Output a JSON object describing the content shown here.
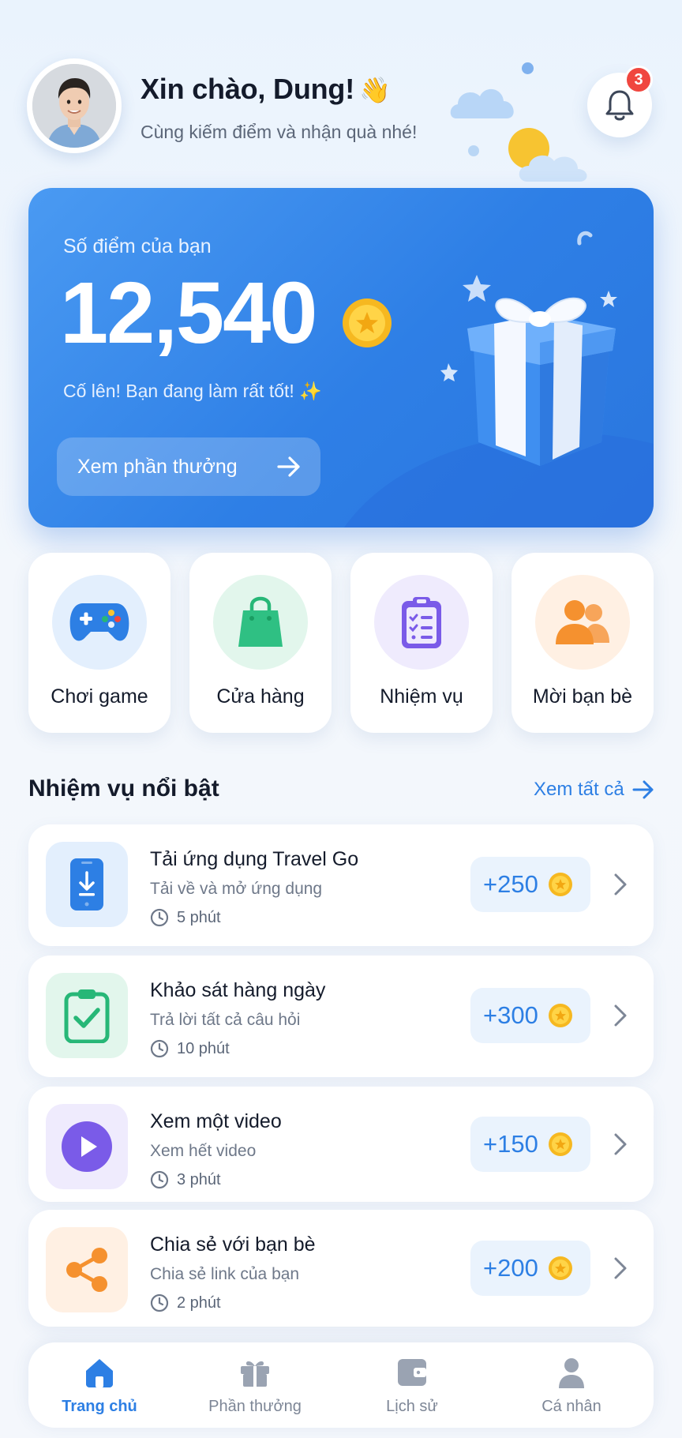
{
  "header": {
    "greeting": "Xin chào, Dung!",
    "wave_emoji": "👋",
    "subtitle": "Cùng kiếm điểm và nhận quà nhé!",
    "notification_count": "3"
  },
  "points_card": {
    "label": "Số điểm của bạn",
    "value": "12,540",
    "cheer": "Cố lên! Bạn đang làm rất tốt! ✨",
    "button_label": "Xem phần thưởng"
  },
  "quick_actions": [
    {
      "label": "Chơi game",
      "icon": "gamepad-icon",
      "bg": "#e3effd",
      "color": "#2d7fe4"
    },
    {
      "label": "Cửa hàng",
      "icon": "shopping-bag-icon",
      "bg": "#e2f6ec",
      "color": "#27b777"
    },
    {
      "label": "Nhiệm vụ",
      "icon": "clipboard-list-icon",
      "bg": "#efebfd",
      "color": "#7a5be8"
    },
    {
      "label": "Mời bạn bè",
      "icon": "users-icon",
      "bg": "#fff0e3",
      "color": "#f5912f"
    }
  ],
  "featured": {
    "title": "Nhiệm vụ nổi bật",
    "see_all": "Xem tất cả"
  },
  "missions": [
    {
      "title": "Tải ứng dụng Travel Go",
      "desc": "Tải về và mở ứng dụng",
      "time": "5 phút",
      "points": "+250",
      "icon": "phone-download-icon"
    },
    {
      "title": "Khảo sát hàng ngày",
      "desc": "Trả lời tất cả câu hỏi",
      "time": "10 phút",
      "points": "+300",
      "icon": "clipboard-check-icon"
    },
    {
      "title": "Xem một video",
      "desc": "Xem hết video",
      "time": "3 phút",
      "points": "+150",
      "icon": "play-icon"
    },
    {
      "title": "Chia sẻ với bạn bè",
      "desc": "Chia sẻ link của bạn",
      "time": "2 phút",
      "points": "+200",
      "icon": "share-icon"
    }
  ],
  "bottom_nav": [
    {
      "label": "Trang chủ",
      "icon": "home-icon",
      "active": true
    },
    {
      "label": "Phần thưởng",
      "icon": "gift-icon",
      "active": false
    },
    {
      "label": "Lịch sử",
      "icon": "wallet-icon",
      "active": false
    },
    {
      "label": "Cá nhân",
      "icon": "user-icon",
      "active": false
    }
  ],
  "colors": {
    "primary": "#2d7fe4",
    "badge": "#f0463f",
    "coin": "#f6b820"
  }
}
